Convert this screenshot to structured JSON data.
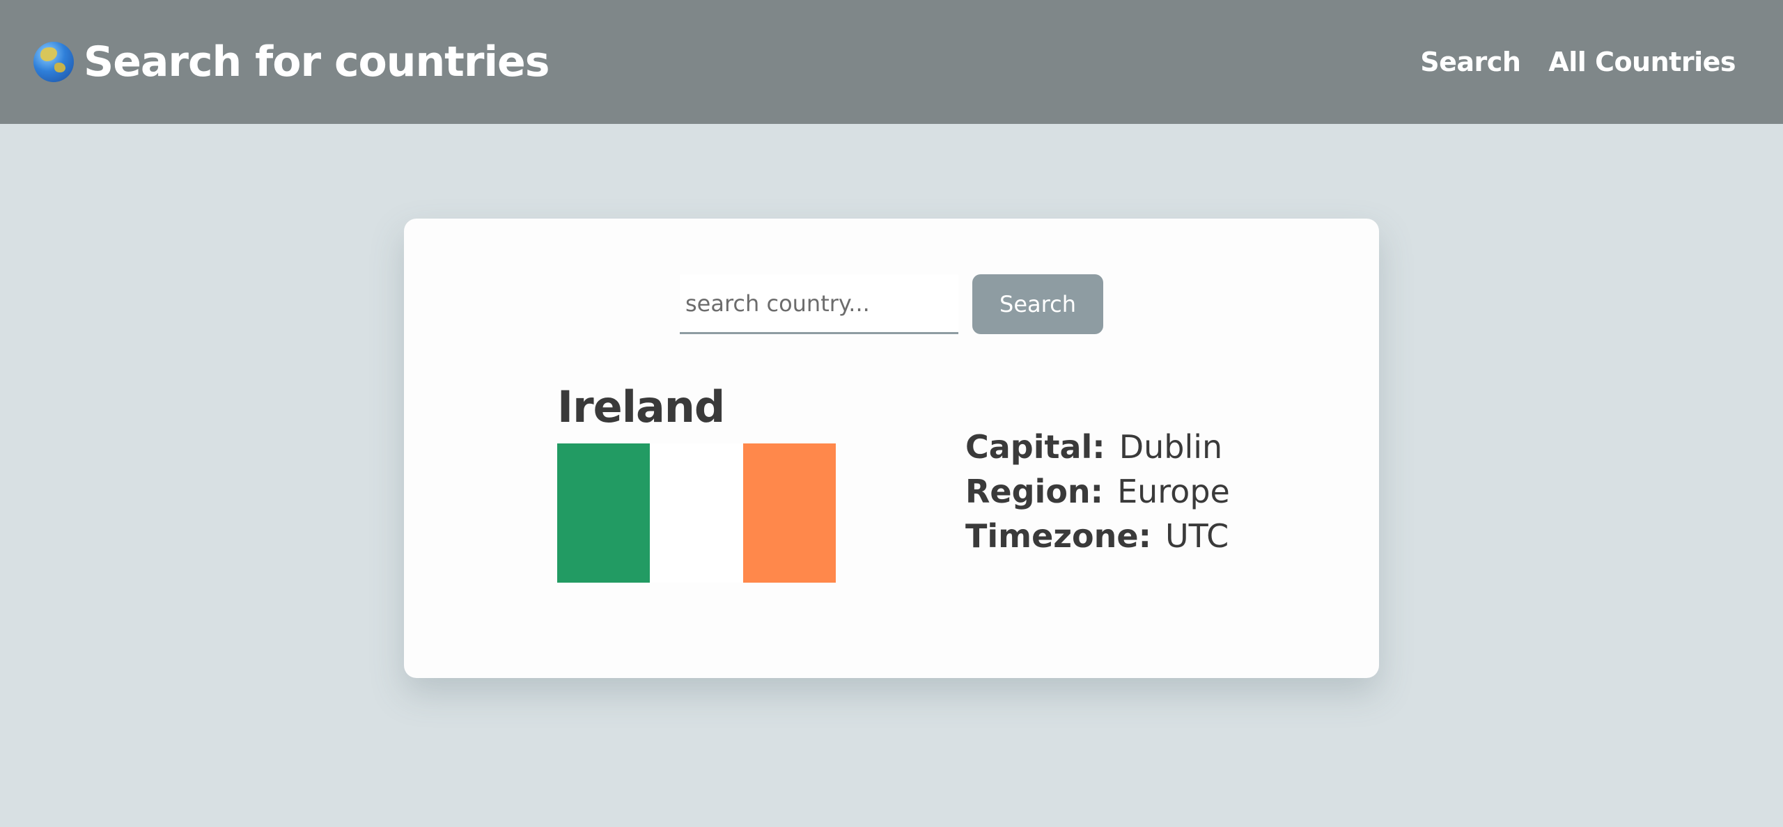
{
  "header": {
    "title": "Search for countries",
    "logo_icon": "globe-asia-australia-icon",
    "nav": [
      {
        "label": "Search"
      },
      {
        "label": "All Countries"
      }
    ]
  },
  "search": {
    "placeholder": "search country...",
    "value": "",
    "button_label": "Search"
  },
  "country": {
    "name": "Ireland",
    "flag_colors": [
      "#229b63",
      "#ffffff",
      "#ff884b"
    ],
    "details": [
      {
        "label": "Capital:",
        "value": "Dublin"
      },
      {
        "label": "Region:",
        "value": "Europe"
      },
      {
        "label": "Timezone:",
        "value": "UTC"
      }
    ]
  },
  "colors": {
    "header_bg": "#7f8789",
    "page_bg": "#d8e0e3",
    "button_bg": "#8e9ca2",
    "text": "#3a3a3a"
  }
}
